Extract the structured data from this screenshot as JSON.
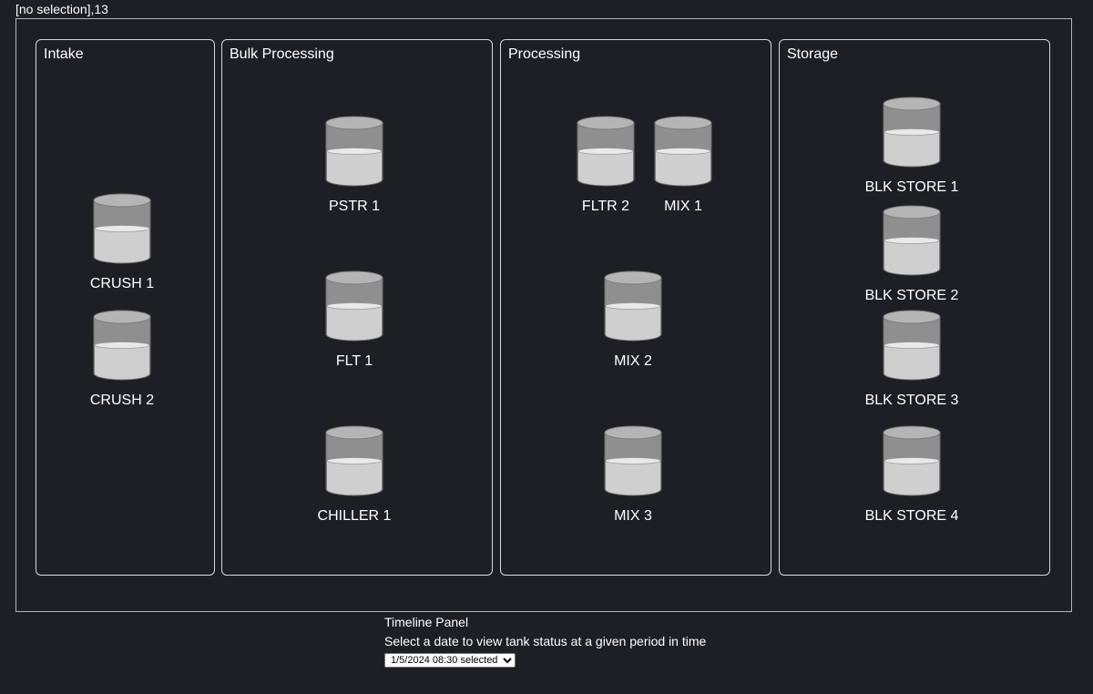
{
  "status": "[no selection],13",
  "areas": [
    {
      "title": "Intake"
    },
    {
      "title": "Bulk Processing"
    },
    {
      "title": "Processing"
    },
    {
      "title": "Storage"
    }
  ],
  "tanks": [
    {
      "label": "CRUSH 1"
    },
    {
      "label": "CRUSH 2"
    },
    {
      "label": "PSTR 1"
    },
    {
      "label": "FLT 1"
    },
    {
      "label": "CHILLER 1"
    },
    {
      "label": "FLTR 2"
    },
    {
      "label": "MIX 1"
    },
    {
      "label": "MIX 2"
    },
    {
      "label": "MIX 3"
    },
    {
      "label": "BLK STORE 1"
    },
    {
      "label": "BLK STORE 2"
    },
    {
      "label": "BLK STORE 3"
    },
    {
      "label": "BLK STORE 4"
    }
  ],
  "timeline": {
    "title": "Timeline Panel",
    "description": "Select a date to view tank status at a given period in time",
    "selected": "1/5/2024 08:30 selected"
  },
  "colors": {
    "background": "#1e1f24",
    "tank_body": "#8f8f8f",
    "tank_liquid": "#cfcfcf",
    "border": "#d8d8d8"
  }
}
